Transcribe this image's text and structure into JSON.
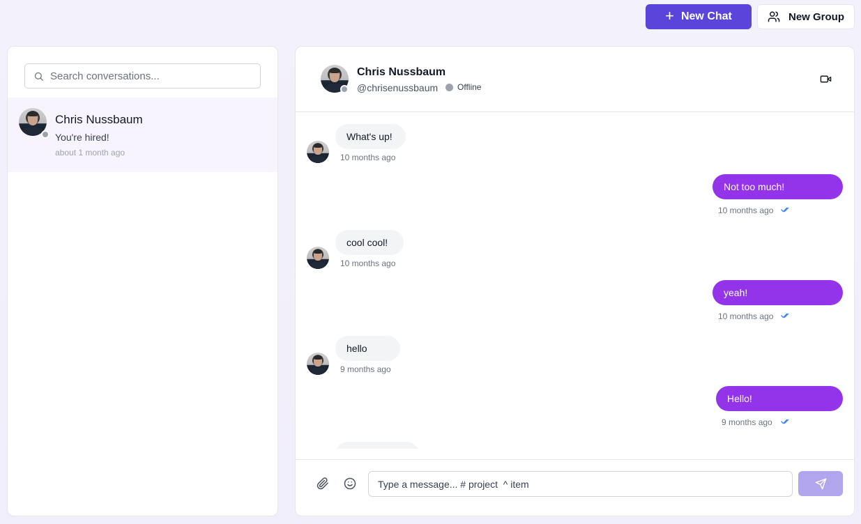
{
  "header": {
    "new_chat_label": "New Chat",
    "new_group_label": "New Group",
    "accent": "#5b44d9"
  },
  "sidebar": {
    "search": {
      "placeholder": "Search conversations..."
    },
    "conversations": [
      {
        "name": "Chris Nussbaum",
        "last_message": "You're hired!",
        "time": "about 1 month ago",
        "status": "offline"
      }
    ]
  },
  "chat": {
    "contact": {
      "name": "Chris Nussbaum",
      "handle": "@chrisenussbaum",
      "status": "Offline"
    },
    "messages": [
      {
        "direction": "in",
        "text": "What's up!",
        "time": "10 months ago"
      },
      {
        "direction": "out",
        "text": "Not too much!",
        "time": "10 months ago",
        "read": true
      },
      {
        "direction": "in",
        "text": "cool cool!",
        "time": "10 months ago"
      },
      {
        "direction": "out",
        "text": "yeah!",
        "time": "10 months ago",
        "read": true
      },
      {
        "direction": "in",
        "text": "hello",
        "time": "9 months ago"
      },
      {
        "direction": "out",
        "text": "Hello!",
        "time": "9 months ago",
        "read": true
      }
    ],
    "composer": {
      "placeholder": "Type a message... # project  ^ item"
    },
    "colors": {
      "outgoing_bubble": "#9333ea",
      "incoming_bubble": "#f3f4f6",
      "send_button": "#b1a5ee"
    }
  }
}
